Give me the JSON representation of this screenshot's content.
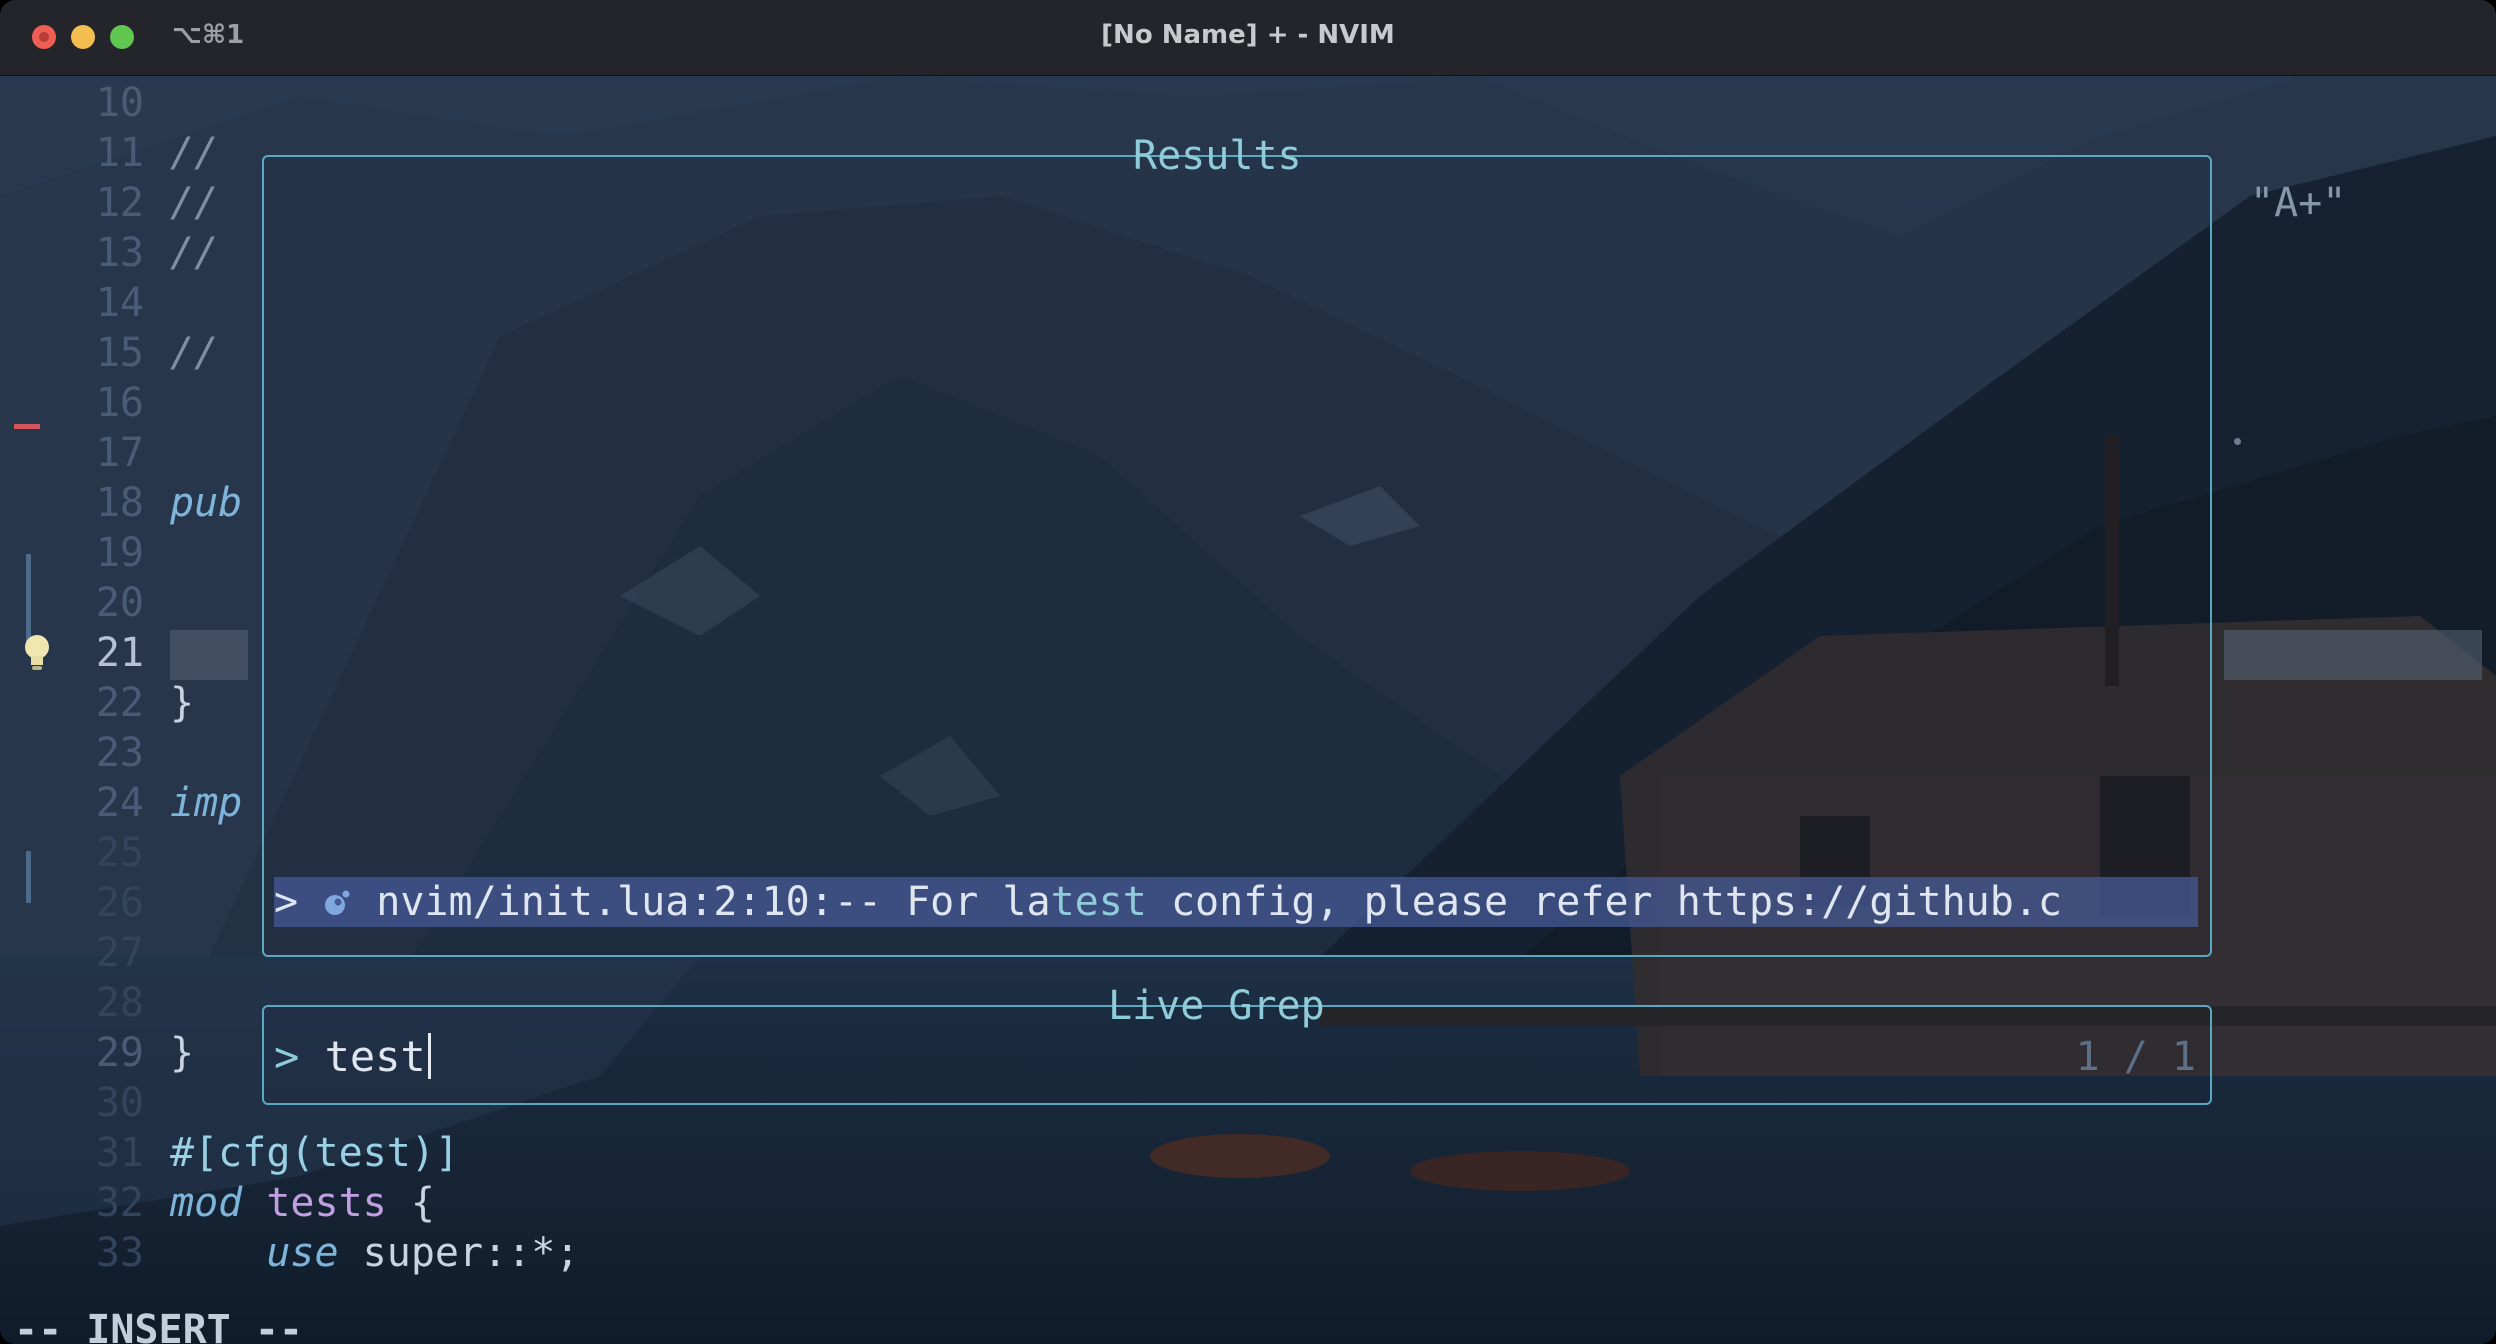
{
  "window": {
    "title": "[No Name] + - NVIM",
    "shortcut": "⌥⌘1"
  },
  "editor": {
    "lines": [
      {
        "num": "10",
        "text": ""
      },
      {
        "num": "11",
        "text": "//"
      },
      {
        "num": "12",
        "text": "//"
      },
      {
        "num": "13",
        "text": "//"
      },
      {
        "num": "14",
        "text": ""
      },
      {
        "num": "15",
        "text": "//"
      },
      {
        "num": "16",
        "text": ""
      },
      {
        "num": "17",
        "text": ""
      },
      {
        "num": "18",
        "text": "pub"
      },
      {
        "num": "19",
        "text": ""
      },
      {
        "num": "20",
        "text": ""
      },
      {
        "num": "21",
        "text": ""
      },
      {
        "num": "22",
        "text": "}"
      },
      {
        "num": "23",
        "text": ""
      },
      {
        "num": "24",
        "text": "imp"
      },
      {
        "num": "25",
        "text": ""
      },
      {
        "num": "26",
        "text": ""
      },
      {
        "num": "27",
        "text": ""
      },
      {
        "num": "28",
        "text": ""
      },
      {
        "num": "29",
        "text": "}"
      },
      {
        "num": "30",
        "text": ""
      },
      {
        "num": "31",
        "text": "#[cfg(test)]"
      },
      {
        "num": "32",
        "text": "mod tests {"
      },
      {
        "num": "33",
        "text": "    use super::*;"
      }
    ],
    "right_string": "\"A+\"",
    "mode": "-- INSERT --"
  },
  "telescope": {
    "results_title": "Results",
    "selected_prefix": "> ",
    "selected_icon": "lua-icon",
    "selected_before": "nvim/init.lua:2:10:-- For la",
    "selected_match": "test",
    "selected_after": " config, please refer https://github.c",
    "prompt_title": "Live Grep",
    "prompt_prefix": "> ",
    "prompt_value": "test",
    "counter": "1 / 1"
  },
  "colors": {
    "border": "#5aa8c2",
    "selection": "#465a96",
    "git_delete": "#d2545a"
  }
}
